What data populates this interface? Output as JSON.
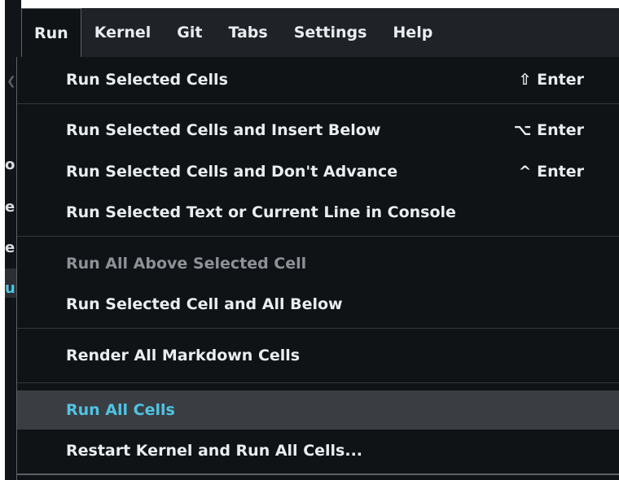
{
  "menubar": {
    "items": [
      {
        "label": "Run",
        "active": true
      },
      {
        "label": "Kernel",
        "active": false
      },
      {
        "label": "Git",
        "active": false
      },
      {
        "label": "Tabs",
        "active": false
      },
      {
        "label": "Settings",
        "active": false
      },
      {
        "label": "Help",
        "active": false
      }
    ]
  },
  "run_menu": {
    "items": [
      {
        "label": "Run Selected Cells",
        "shortcut": "⇧ Enter",
        "enabled": true
      },
      {
        "label": "Run Selected Cells and Insert Below",
        "shortcut": "⌥ Enter",
        "enabled": true
      },
      {
        "label": "Run Selected Cells and Don't Advance",
        "shortcut": "^ Enter",
        "enabled": true
      },
      {
        "label": "Run Selected Text or Current Line in Console",
        "shortcut": "",
        "enabled": true
      },
      {
        "label": "Run All Above Selected Cell",
        "shortcut": "",
        "enabled": false
      },
      {
        "label": "Run Selected Cell and All Below",
        "shortcut": "",
        "enabled": true
      },
      {
        "label": "Render All Markdown Cells",
        "shortcut": "",
        "enabled": true
      },
      {
        "label": "Run All Cells",
        "shortcut": "",
        "enabled": true,
        "highlighted": true
      },
      {
        "label": "Restart Kernel and Run All Cells...",
        "shortcut": "",
        "enabled": true
      }
    ]
  },
  "background_fragments": {
    "rows": [
      "o",
      "e",
      "e",
      "u"
    ]
  },
  "colors": {
    "menu_bg": "#101316",
    "menubar_bg": "#1f2226",
    "highlight_bg": "#3a3e43",
    "highlight_text": "#50c4e3",
    "text": "#eaedf0",
    "disabled_text": "#8d9298"
  }
}
